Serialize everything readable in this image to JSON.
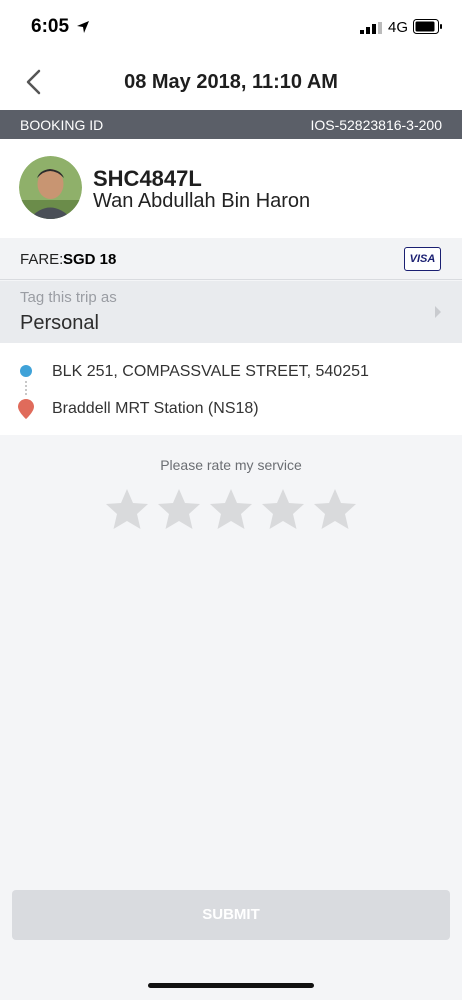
{
  "status_bar": {
    "time": "6:05",
    "network": "4G"
  },
  "header": {
    "title": "08 May 2018, 11:10 AM"
  },
  "booking": {
    "label": "BOOKING ID",
    "value": "IOS-52823816-3-200"
  },
  "driver": {
    "plate": "SHC4847L",
    "name": "Wan Abdullah Bin Haron"
  },
  "fare": {
    "label": "FARE:",
    "value": "SGD 18",
    "payment_method": "VISA"
  },
  "tag": {
    "label": "Tag this trip as",
    "value": "Personal"
  },
  "route": {
    "pickup": "BLK 251, COMPASSVALE STREET, 540251",
    "dropoff": "Braddell MRT Station (NS18)"
  },
  "rating": {
    "prompt": "Please rate my service",
    "stars_total": 5,
    "stars_selected": 0
  },
  "submit_label": "SUBMIT",
  "colors": {
    "booking_bar": "#5b5f68",
    "pickup_dot": "#3fa2d8",
    "dropoff_pin": "#e06b5b",
    "star_empty": "#d9dadc",
    "submit_disabled": "#d9dbdf"
  },
  "icons": {
    "location_services": "location-arrow-icon",
    "signal": "cellular-signal-icon",
    "battery": "battery-icon",
    "back": "chevron-left-icon",
    "tag_chevron": "chevron-right-icon",
    "pickup": "pickup-dot-icon",
    "dropoff": "map-pin-icon",
    "star": "star-icon"
  }
}
